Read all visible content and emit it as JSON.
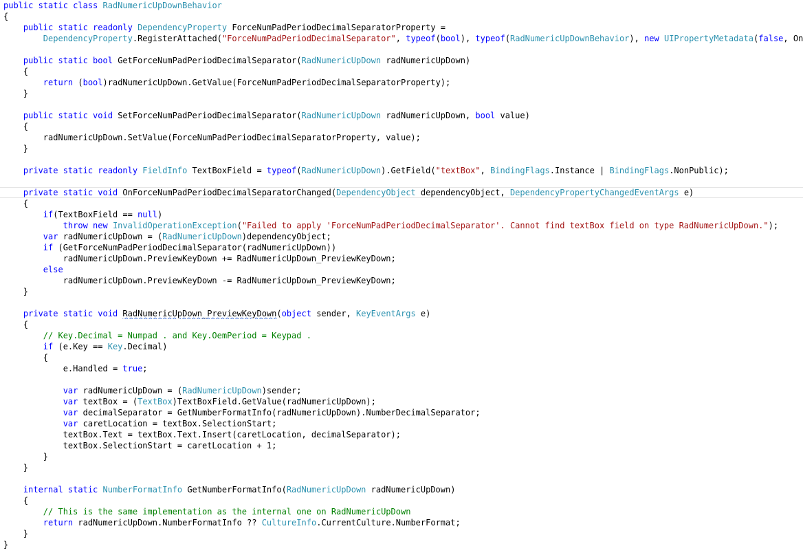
{
  "colors": {
    "keyword": "#0000ff",
    "type": "#2b91af",
    "string": "#a31515",
    "comment": "#008000",
    "text": "#000000",
    "background": "#ffffff"
  },
  "lines": [
    [
      [
        "kw",
        "public static class "
      ],
      [
        "tp",
        "RadNumericUpDownBehavior"
      ]
    ],
    [
      [
        "tx",
        "{"
      ]
    ],
    [
      [
        "tx",
        "    "
      ],
      [
        "kw",
        "public static readonly "
      ],
      [
        "tp",
        "DependencyProperty"
      ],
      [
        "tx",
        " ForceNumPadPeriodDecimalSeparatorProperty ="
      ]
    ],
    [
      [
        "tx",
        "        "
      ],
      [
        "tp",
        "DependencyProperty"
      ],
      [
        "tx",
        ".RegisterAttached("
      ],
      [
        "st",
        "\"ForceNumPadPeriodDecimalSeparator\""
      ],
      [
        "tx",
        ", "
      ],
      [
        "kw",
        "typeof"
      ],
      [
        "tx",
        "("
      ],
      [
        "kw",
        "bool"
      ],
      [
        "tx",
        "), "
      ],
      [
        "kw",
        "typeof"
      ],
      [
        "tx",
        "("
      ],
      [
        "tp",
        "RadNumericUpDownBehavior"
      ],
      [
        "tx",
        "), "
      ],
      [
        "kw",
        "new "
      ],
      [
        "tp",
        "UIPropertyMetadata"
      ],
      [
        "tx",
        "("
      ],
      [
        "kw",
        "false"
      ],
      [
        "tx",
        ", OnForceN"
      ]
    ],
    [],
    [
      [
        "tx",
        "    "
      ],
      [
        "kw",
        "public static bool "
      ],
      [
        "tx",
        "GetForceNumPadPeriodDecimalSeparator("
      ],
      [
        "tp",
        "RadNumericUpDown"
      ],
      [
        "tx",
        " radNumericUpDown)"
      ]
    ],
    [
      [
        "tx",
        "    {"
      ]
    ],
    [
      [
        "tx",
        "        "
      ],
      [
        "kw",
        "return "
      ],
      [
        "tx",
        "("
      ],
      [
        "kw",
        "bool"
      ],
      [
        "tx",
        ")radNumericUpDown.GetValue(ForceNumPadPeriodDecimalSeparatorProperty);"
      ]
    ],
    [
      [
        "tx",
        "    }"
      ]
    ],
    [],
    [
      [
        "tx",
        "    "
      ],
      [
        "kw",
        "public static void "
      ],
      [
        "tx",
        "SetForceNumPadPeriodDecimalSeparator("
      ],
      [
        "tp",
        "RadNumericUpDown"
      ],
      [
        "tx",
        " radNumericUpDown, "
      ],
      [
        "kw",
        "bool"
      ],
      [
        "tx",
        " value)"
      ]
    ],
    [
      [
        "tx",
        "    {"
      ]
    ],
    [
      [
        "tx",
        "        radNumericUpDown.SetValue(ForceNumPadPeriodDecimalSeparatorProperty, value);"
      ]
    ],
    [
      [
        "tx",
        "    }"
      ]
    ],
    [],
    [
      [
        "tx",
        "    "
      ],
      [
        "kw",
        "private static readonly "
      ],
      [
        "tp",
        "FieldInfo"
      ],
      [
        "tx",
        " TextBoxField = "
      ],
      [
        "kw",
        "typeof"
      ],
      [
        "tx",
        "("
      ],
      [
        "tp",
        "RadNumericUpDown"
      ],
      [
        "tx",
        ").GetField("
      ],
      [
        "st",
        "\"textBox\""
      ],
      [
        "tx",
        ", "
      ],
      [
        "tp",
        "BindingFlags"
      ],
      [
        "tx",
        ".Instance | "
      ],
      [
        "tp",
        "BindingFlags"
      ],
      [
        "tx",
        ".NonPublic);"
      ]
    ],
    [],
    [
      [
        "tx",
        "    "
      ],
      [
        "kw",
        "private static void "
      ],
      [
        "tx",
        "OnForceNumPadPeriodDecimalSeparatorChanged("
      ],
      [
        "tp",
        "DependencyObject"
      ],
      [
        "tx",
        " dependencyObject, "
      ],
      [
        "tp",
        "DependencyPropertyChangedEventArgs"
      ],
      [
        "tx",
        " e)"
      ]
    ],
    [
      [
        "tx",
        "    {"
      ]
    ],
    [
      [
        "tx",
        "        "
      ],
      [
        "kw",
        "if"
      ],
      [
        "tx",
        "(TextBoxField == "
      ],
      [
        "kw",
        "null"
      ],
      [
        "tx",
        ")"
      ]
    ],
    [
      [
        "tx",
        "            "
      ],
      [
        "kw",
        "throw new "
      ],
      [
        "tp",
        "InvalidOperationException"
      ],
      [
        "tx",
        "("
      ],
      [
        "st",
        "\"Failed to apply 'ForceNumPadPeriodDecimalSeparator'. Cannot find textBox field on type RadNumericUpDown.\""
      ],
      [
        "tx",
        ");"
      ]
    ],
    [
      [
        "tx",
        "        "
      ],
      [
        "kw",
        "var"
      ],
      [
        "tx",
        " radNumericUpDown = ("
      ],
      [
        "tp",
        "RadNumericUpDown"
      ],
      [
        "tx",
        ")dependencyObject;"
      ]
    ],
    [
      [
        "tx",
        "        "
      ],
      [
        "kw",
        "if"
      ],
      [
        "tx",
        " (GetForceNumPadPeriodDecimalSeparator(radNumericUpDown))"
      ]
    ],
    [
      [
        "tx",
        "            radNumericUpDown.PreviewKeyDown += RadNumericUpDown_PreviewKeyDown;"
      ]
    ],
    [
      [
        "tx",
        "        "
      ],
      [
        "kw",
        "else"
      ]
    ],
    [
      [
        "tx",
        "            radNumericUpDown.PreviewKeyDown -= RadNumericUpDown_PreviewKeyDown;"
      ]
    ],
    [
      [
        "tx",
        "    }"
      ]
    ],
    [],
    [
      [
        "tx",
        "    "
      ],
      [
        "kw",
        "private static void "
      ],
      [
        "sq",
        "RadNumericUpDown_PreviewKeyDown"
      ],
      [
        "tx",
        "("
      ],
      [
        "kw",
        "object"
      ],
      [
        "tx",
        " sender, "
      ],
      [
        "tp",
        "KeyEventArgs"
      ],
      [
        "tx",
        " e)"
      ]
    ],
    [
      [
        "tx",
        "    {"
      ]
    ],
    [
      [
        "tx",
        "        "
      ],
      [
        "cm",
        "// Key.Decimal = Numpad . and Key.OemPeriod = Keypad ."
      ]
    ],
    [
      [
        "tx",
        "        "
      ],
      [
        "kw",
        "if"
      ],
      [
        "tx",
        " (e.Key == "
      ],
      [
        "tp",
        "Key"
      ],
      [
        "tx",
        ".Decimal)"
      ]
    ],
    [
      [
        "tx",
        "        {"
      ]
    ],
    [
      [
        "tx",
        "            e.Handled = "
      ],
      [
        "kw",
        "true"
      ],
      [
        "tx",
        ";"
      ]
    ],
    [],
    [
      [
        "tx",
        "            "
      ],
      [
        "kw",
        "var"
      ],
      [
        "tx",
        " radNumericUpDown = ("
      ],
      [
        "tp",
        "RadNumericUpDown"
      ],
      [
        "tx",
        ")sender;"
      ]
    ],
    [
      [
        "tx",
        "            "
      ],
      [
        "kw",
        "var"
      ],
      [
        "tx",
        " textBox = ("
      ],
      [
        "tp",
        "TextBox"
      ],
      [
        "tx",
        ")TextBoxField.GetValue(radNumericUpDown);"
      ]
    ],
    [
      [
        "tx",
        "            "
      ],
      [
        "kw",
        "var"
      ],
      [
        "tx",
        " decimalSeparator = GetNumberFormatInfo(radNumericUpDown).NumberDecimalSeparator;"
      ]
    ],
    [
      [
        "tx",
        "            "
      ],
      [
        "kw",
        "var"
      ],
      [
        "tx",
        " caretLocation = textBox.SelectionStart;"
      ]
    ],
    [
      [
        "tx",
        "            textBox.Text = textBox.Text.Insert(caretLocation, decimalSeparator);"
      ]
    ],
    [
      [
        "tx",
        "            textBox.SelectionStart = caretLocation + 1;"
      ]
    ],
    [
      [
        "tx",
        "        }"
      ]
    ],
    [
      [
        "tx",
        "    }"
      ]
    ],
    [],
    [
      [
        "tx",
        "    "
      ],
      [
        "kw",
        "internal static "
      ],
      [
        "tp",
        "NumberFormatInfo"
      ],
      [
        "tx",
        " GetNumberFormatInfo("
      ],
      [
        "tp",
        "RadNumericUpDown"
      ],
      [
        "tx",
        " radNumericUpDown)"
      ]
    ],
    [
      [
        "tx",
        "    {"
      ]
    ],
    [
      [
        "tx",
        "        "
      ],
      [
        "cm",
        "// This is the same implementation as the internal one on RadNumericUpDown"
      ]
    ],
    [
      [
        "tx",
        "        "
      ],
      [
        "kw",
        "return"
      ],
      [
        "tx",
        " radNumericUpDown.NumberFormatInfo ?? "
      ],
      [
        "tp",
        "CultureInfo"
      ],
      [
        "tx",
        ".CurrentCulture.NumberFormat;"
      ]
    ],
    [
      [
        "tx",
        "    }"
      ]
    ],
    [
      [
        "tx",
        "}"
      ]
    ]
  ]
}
